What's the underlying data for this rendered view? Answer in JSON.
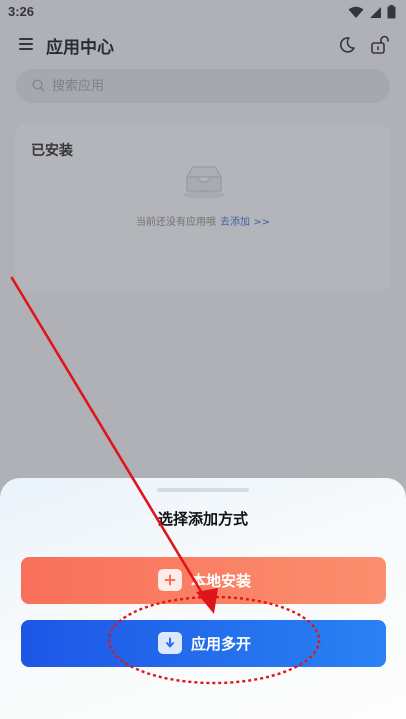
{
  "status_bar": {
    "time": "3:26"
  },
  "header": {
    "title": "应用中心"
  },
  "search": {
    "placeholder": "搜索应用"
  },
  "installed": {
    "title": "已安装",
    "empty_text": "当前还没有应用哦",
    "add_link": "去添加 >>"
  },
  "sheet": {
    "title": "选择添加方式",
    "options": [
      {
        "label": "本地安装",
        "color": "#f9705a"
      },
      {
        "label": "应用多开",
        "color": "#1d56e6"
      }
    ]
  },
  "colors": {
    "accent": "#2f6fd8",
    "annotation": "#e0141b"
  }
}
